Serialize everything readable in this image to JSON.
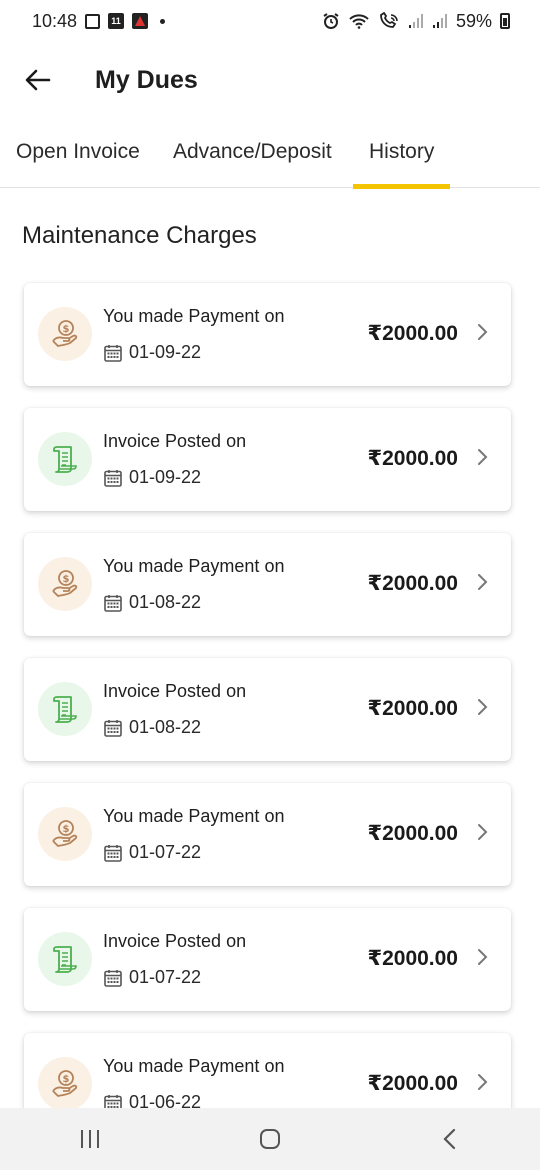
{
  "status_bar": {
    "time": "10:48",
    "calendar_day": "11",
    "battery": "59%"
  },
  "header": {
    "title": "My Dues",
    "back_icon": "arrow-left-icon"
  },
  "tabs": [
    {
      "label": "Open Invoice",
      "active": false
    },
    {
      "label": "Advance/Deposit",
      "active": false
    },
    {
      "label": "History",
      "active": true
    }
  ],
  "colors": {
    "accent": "#f5c400",
    "payment_bg": "#fbf0e4",
    "payment_icon": "#b5835a",
    "invoice_bg": "#e8f7ea",
    "invoice_icon": "#4caf50"
  },
  "section": {
    "title": "Maintenance Charges"
  },
  "entries": [
    {
      "type": "payment",
      "label": "You made Payment on",
      "date": "01-09-22",
      "amount": "₹2000.00"
    },
    {
      "type": "invoice",
      "label": "Invoice Posted on",
      "date": "01-09-22",
      "amount": "₹2000.00"
    },
    {
      "type": "payment",
      "label": "You made Payment on",
      "date": "01-08-22",
      "amount": "₹2000.00"
    },
    {
      "type": "invoice",
      "label": "Invoice Posted on",
      "date": "01-08-22",
      "amount": "₹2000.00"
    },
    {
      "type": "payment",
      "label": "You made Payment on",
      "date": "01-07-22",
      "amount": "₹2000.00"
    },
    {
      "type": "invoice",
      "label": "Invoice Posted on",
      "date": "01-07-22",
      "amount": "₹2000.00"
    },
    {
      "type": "payment",
      "label": "You made Payment on",
      "date": "01-06-22",
      "amount": "₹2000.00"
    }
  ],
  "nav": {
    "recents_icon": "recents-icon",
    "home_icon": "home-icon",
    "back_icon": "back-icon"
  }
}
